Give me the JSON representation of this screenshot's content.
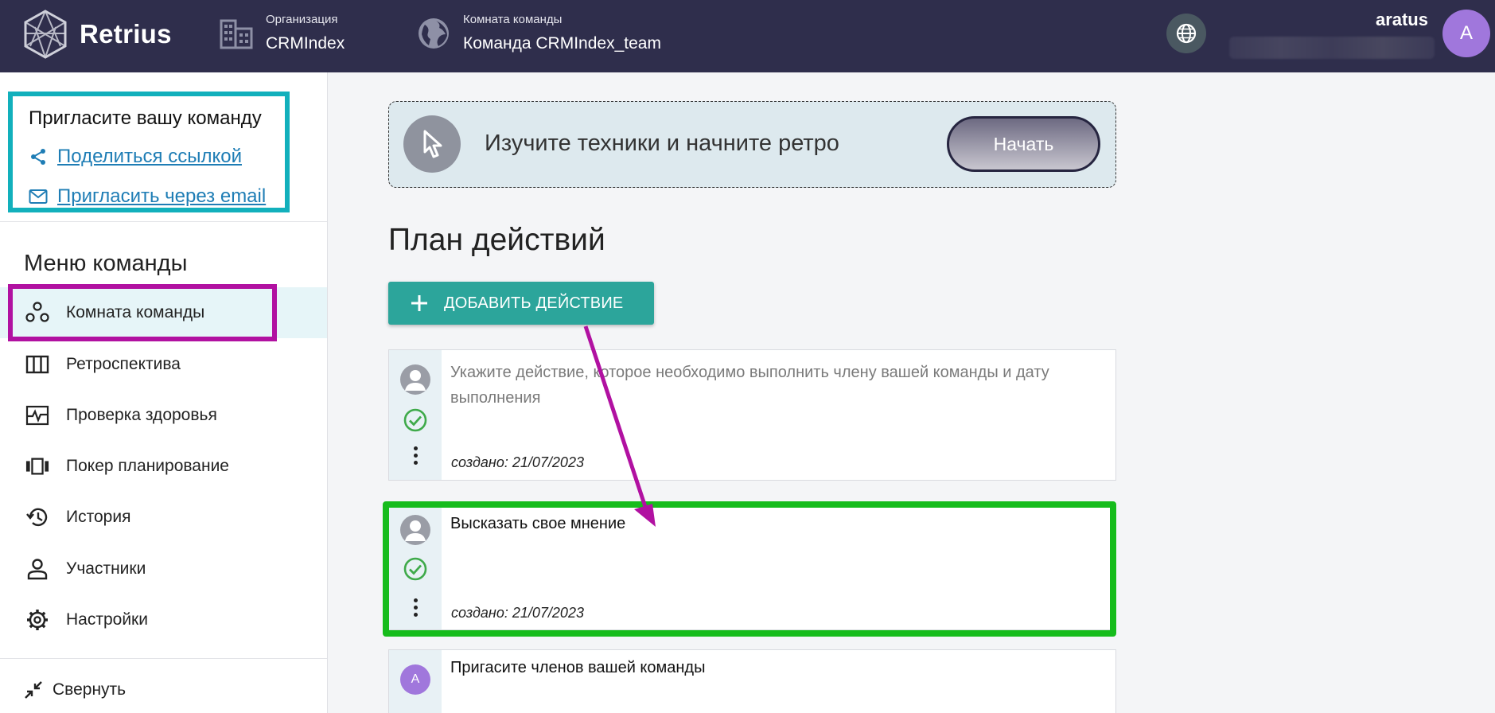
{
  "header": {
    "logo_text": "Retrius",
    "organization": {
      "label": "Организация",
      "value": "CRMIndex"
    },
    "team_room": {
      "label": "Комната команды",
      "value": "Команда CRMIndex_team"
    },
    "username": "aratus",
    "avatar_letter": "A"
  },
  "sidebar": {
    "invite": {
      "title": "Пригласите вашу команду",
      "share_link": "Поделиться ссылкой",
      "email_invite": "Пригласить через email"
    },
    "menu_title": "Меню команды",
    "items": [
      {
        "label": "Комната команды",
        "icon": "people-icon"
      },
      {
        "label": "Ретроспектива",
        "icon": "columns-icon"
      },
      {
        "label": "Проверка здоровья",
        "icon": "pulse-icon"
      },
      {
        "label": "Покер планирование",
        "icon": "cards-icon"
      },
      {
        "label": "История",
        "icon": "history-icon"
      },
      {
        "label": "Участники",
        "icon": "person-icon"
      },
      {
        "label": "Настройки",
        "icon": "gear-icon"
      }
    ],
    "collapse_label": "Свернуть"
  },
  "main": {
    "banner": {
      "text": "Изучите техники и начните ретро",
      "button": "Начать"
    },
    "section_title": "План действий",
    "add_button": "ДОБАВИТЬ ДЕЙСТВИЕ",
    "cards": [
      {
        "text": "Укажите действие, которое необходимо выполнить члену вашей команды и дату выполнения",
        "created_label": "создано:",
        "created_date": "21/07/2023",
        "placeholder": true
      },
      {
        "text": "Высказать свое мнение",
        "created_label": "создано:",
        "created_date": "21/07/2023"
      },
      {
        "text": "Пригасите членов вашей команды",
        "avatar_letter": "A"
      }
    ]
  },
  "colors": {
    "topbar": "#2f2e4c",
    "accent_teal": "#2ca59b",
    "highlight_cyan": "#12b0bc",
    "highlight_magenta": "#b111a1",
    "highlight_green": "#16bc1c",
    "check_green": "#3faa4a",
    "avatar_purple": "#a077dc"
  }
}
